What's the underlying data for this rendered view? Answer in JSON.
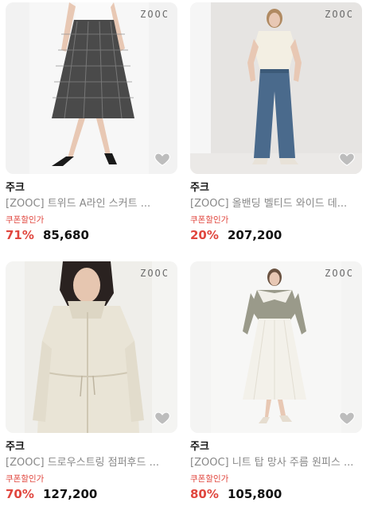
{
  "products": [
    {
      "brand_watermark": "ZOOC",
      "seller": "주크",
      "title": "[ZOOC] 트위드 A라인 스커트 ...",
      "coupon_label": "쿠폰할인가",
      "discount_rate": "71%",
      "price": "85,680"
    },
    {
      "brand_watermark": "ZOOC",
      "seller": "주크",
      "title": "[ZOOC] 올밴딩 벨티드 와이드 데...",
      "coupon_label": "쿠폰할인가",
      "discount_rate": "20%",
      "price": "207,200"
    },
    {
      "brand_watermark": "ZOOC",
      "seller": "주크",
      "title": "[ZOOC] 드로우스트링 점퍼후드 ...",
      "coupon_label": "쿠폰할인가",
      "discount_rate": "70%",
      "price": "127,200"
    },
    {
      "brand_watermark": "ZOOC",
      "seller": "주크",
      "title": "[ZOOC] 니트 탑 망사 주름 원피스 ...",
      "coupon_label": "쿠폰할인가",
      "discount_rate": "80%",
      "price": "105,800"
    }
  ],
  "icons": {
    "wishlist": "heart-icon"
  },
  "colors": {
    "discount": "#e0463e",
    "heart": "#bdbdbd"
  }
}
